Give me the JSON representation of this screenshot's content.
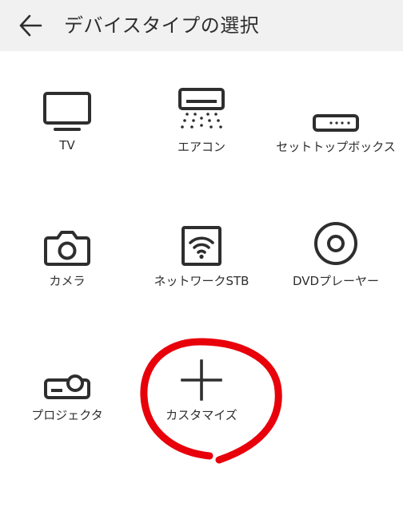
{
  "header": {
    "title": "デバイスタイプの選択",
    "back_icon": "arrow-left-icon"
  },
  "devices": [
    {
      "label": "TV",
      "icon": "tv-icon"
    },
    {
      "label": "エアコン",
      "icon": "air-conditioner-icon"
    },
    {
      "label": "セットトップボックス",
      "icon": "set-top-box-icon"
    },
    {
      "label": "カメラ",
      "icon": "camera-icon"
    },
    {
      "label": "ネットワークSTB",
      "icon": "network-stb-icon"
    },
    {
      "label": "DVDプレーヤー",
      "icon": "disc-icon"
    },
    {
      "label": "プロジェクタ",
      "icon": "projector-icon"
    },
    {
      "label": "カスタマイズ",
      "icon": "plus-icon"
    }
  ],
  "colors": {
    "header_bg": "#f1f1f1",
    "icon": "#2e2e2e",
    "annotation": "#e8000b"
  }
}
